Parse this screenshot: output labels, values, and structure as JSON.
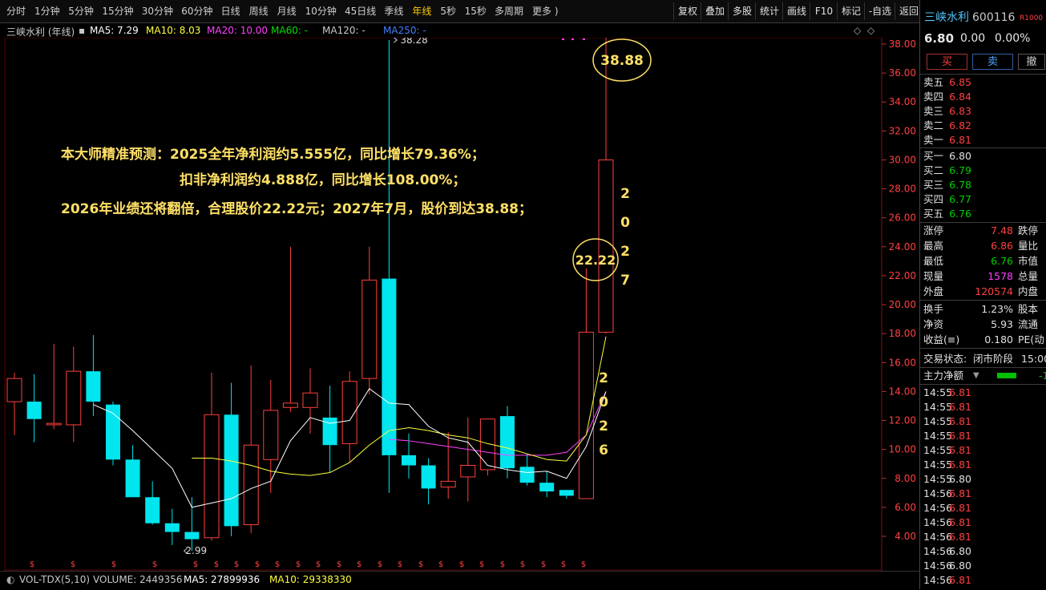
{
  "tabs": [
    "分时",
    "1分钟",
    "5分钟",
    "15分钟",
    "30分钟",
    "60分钟",
    "日线",
    "周线",
    "月线",
    "10分钟",
    "45日线",
    "季线",
    "年线",
    "5秒",
    "15秒",
    "多周期",
    "更多 )"
  ],
  "active_tab": "年线",
  "tools": [
    "复权",
    "叠加",
    "多股",
    "统计",
    "画线",
    "F10",
    "标记",
    "-自选",
    "返回"
  ],
  "info": {
    "name": "三峡水利 (年线)",
    "ma5": "MA5: 7.29",
    "ma10": "MA10: 8.03",
    "ma20": "MA20: 10.00",
    "ma60": "MA60: -",
    "ma120": "MA120: -",
    "ma250": "MA250: -"
  },
  "colors": {
    "up": "#ff4040",
    "down": "#00e5ee",
    "ma5": "#ffffff",
    "ma10": "#ffff40",
    "ma20": "#ff40ff",
    "ma60": "#00e000",
    "ma120": "#40ff40",
    "ma250": "#4080ff",
    "annotation": "#ffe066"
  },
  "annotations": {
    "line1": "本大师精准预测：2025全年净利润约5.555亿，同比增长79.36%；",
    "line2": "扣非净利润约4.888亿，同比增长108.00%；",
    "line3": "2026年业绩还将翻倍，合理股价22.22元；2027年7月，股价到达38.88；"
  },
  "chart_data": {
    "type": "candlestick",
    "y_ticks": [
      "38.00",
      "36.00",
      "34.00",
      "32.00",
      "30.00",
      "28.00",
      "26.00",
      "24.00",
      "22.00",
      "20.00",
      "18.00",
      "16.00",
      "14.00",
      "12.00",
      "10.00",
      "8.00",
      "6.00",
      "4.00"
    ],
    "ylim": [
      2.2,
      39.8
    ],
    "candles": [
      {
        "o": 13.3,
        "h": 15.3,
        "l": 11.0,
        "c": 14.9
      },
      {
        "o": 13.3,
        "h": 15.2,
        "l": 10.5,
        "c": 12.1
      },
      {
        "o": 11.7,
        "h": 17.3,
        "l": 11.4,
        "c": 11.8
      },
      {
        "o": 11.7,
        "h": 17.1,
        "l": 10.5,
        "c": 15.4
      },
      {
        "o": 15.4,
        "h": 17.9,
        "l": 12.3,
        "c": 13.3
      },
      {
        "o": 13.1,
        "h": 13.3,
        "l": 8.9,
        "c": 9.3
      },
      {
        "o": 9.3,
        "h": 10.3,
        "l": 6.9,
        "c": 6.7
      },
      {
        "o": 6.7,
        "h": 7.8,
        "l": 4.8,
        "c": 4.9
      },
      {
        "o": 4.9,
        "h": 5.9,
        "l": 3.4,
        "c": 4.3
      },
      {
        "o": 4.3,
        "h": 6.7,
        "l": 2.99,
        "c": 3.8
      },
      {
        "o": 3.9,
        "h": 15.3,
        "l": 3.7,
        "c": 12.4
      },
      {
        "o": 12.4,
        "h": 14.6,
        "l": 4.0,
        "c": 4.7
      },
      {
        "o": 4.8,
        "h": 15.8,
        "l": 4.2,
        "c": 10.3
      },
      {
        "o": 9.3,
        "h": 14.8,
        "l": 7.0,
        "c": 12.7
      },
      {
        "o": 12.9,
        "h": 24.0,
        "l": 12.6,
        "c": 13.2
      },
      {
        "o": 12.9,
        "h": 15.6,
        "l": 11.1,
        "c": 13.9
      },
      {
        "o": 12.2,
        "h": 14.4,
        "l": 8.4,
        "c": 10.3
      },
      {
        "o": 10.4,
        "h": 15.4,
        "l": 9.1,
        "c": 14.7
      },
      {
        "o": 14.9,
        "h": 24.0,
        "l": 13.8,
        "c": 21.7
      },
      {
        "o": 21.8,
        "h": 38.28,
        "l": 7.0,
        "c": 9.6
      },
      {
        "o": 9.6,
        "h": 11.1,
        "l": 8.0,
        "c": 8.9
      },
      {
        "o": 8.9,
        "h": 9.4,
        "l": 6.2,
        "c": 7.3
      },
      {
        "o": 7.4,
        "h": 11.2,
        "l": 6.6,
        "c": 7.8
      },
      {
        "o": 8.1,
        "h": 12.2,
        "l": 6.4,
        "c": 8.9
      },
      {
        "o": 8.6,
        "h": 12.1,
        "l": 8.2,
        "c": 12.1
      },
      {
        "o": 12.3,
        "h": 13.0,
        "l": 8.0,
        "c": 8.7
      },
      {
        "o": 8.8,
        "h": 9.7,
        "l": 7.5,
        "c": 7.7
      },
      {
        "o": 7.7,
        "h": 8.5,
        "l": 6.7,
        "c": 7.1
      },
      {
        "o": 7.2,
        "h": 7.2,
        "l": 6.6,
        "c": 6.8
      },
      {
        "o": 6.6,
        "h": 22.5,
        "l": 6.6,
        "c": 18.1
      },
      {
        "o": 18.1,
        "h": 38.88,
        "l": 18.0,
        "c": 30.0
      }
    ],
    "ma5": [
      null,
      null,
      null,
      null,
      13.1,
      12.5,
      11.3,
      10.0,
      8.7,
      6.0,
      6.3,
      6.6,
      7.3,
      7.8,
      10.6,
      12.2,
      11.8,
      12.0,
      14.2,
      13.2,
      13.1,
      11.6,
      10.8,
      10.5,
      8.9,
      8.6,
      8.4,
      8.5,
      8.0,
      10.2,
      14.0
    ],
    "ma10": [
      null,
      null,
      null,
      null,
      null,
      null,
      null,
      null,
      null,
      9.4,
      9.4,
      9.2,
      8.9,
      8.5,
      8.3,
      8.2,
      8.4,
      9.1,
      10.3,
      11.3,
      11.5,
      11.3,
      11.0,
      10.8,
      10.4,
      10.1,
      9.7,
      9.3,
      9.2,
      11.0,
      17.8
    ],
    "ma20": [
      null,
      null,
      null,
      null,
      null,
      null,
      null,
      null,
      null,
      null,
      null,
      null,
      null,
      null,
      null,
      null,
      null,
      null,
      null,
      10.7,
      10.6,
      10.4,
      10.2,
      10.0,
      9.8,
      9.6,
      9.6,
      9.6,
      9.8,
      11.0,
      14.0
    ],
    "labels": {
      "high": "38.28",
      "low": "2.99",
      "circle_top": "38.88",
      "circle_mid": "22.22",
      "vert_2026": "2026",
      "vert_2027": "2027"
    }
  },
  "volume": {
    "label": "VOL-TDX(5,10)",
    "volume": "VOLUME: 2449356",
    "ma5": "MA5: 27899936",
    "ma10": "MA10: 29338330"
  },
  "quote": {
    "name": "三峡水利",
    "code": "600116",
    "badge": "R1000",
    "price": "6.80",
    "change": "0.00",
    "pct": "0.00%",
    "buy_label": "买",
    "sell_label": "卖",
    "cancel_label": "撤",
    "asks": [
      {
        "label": "卖五",
        "price": "6.85"
      },
      {
        "label": "卖四",
        "price": "6.84"
      },
      {
        "label": "卖三",
        "price": "6.83"
      },
      {
        "label": "卖二",
        "price": "6.82"
      },
      {
        "label": "卖一",
        "price": "6.81"
      }
    ],
    "bids": [
      {
        "label": "买一",
        "price": "6.80"
      },
      {
        "label": "买二",
        "price": "6.79"
      },
      {
        "label": "买三",
        "price": "6.78"
      },
      {
        "label": "买四",
        "price": "6.77"
      },
      {
        "label": "买五",
        "price": "6.76"
      }
    ],
    "stats": [
      {
        "l": "涨停",
        "v": "7.48",
        "r": "跌停"
      },
      {
        "l": "最高",
        "v": "6.86",
        "r": "量比"
      },
      {
        "l": "最低",
        "v": "6.76",
        "r": "市值"
      },
      {
        "l": "现量",
        "v": "1578",
        "r": "总量"
      },
      {
        "l": "外盘",
        "v": "120574",
        "r": "内盘"
      }
    ],
    "stats2": [
      {
        "l": "换手",
        "v": "1.23%",
        "r": "股本"
      },
      {
        "l": "净资",
        "v": "5.93",
        "r": "流通"
      },
      {
        "l": "收益(≡)",
        "v": "0.180",
        "r": "PE(动"
      }
    ],
    "trade_status_label": "交易状态:",
    "trade_status": "闭市阶段",
    "trade_time": "15:00",
    "net_flow_label": "主力净额",
    "net_flow_value": "-1",
    "ticks": [
      {
        "t": "14:55",
        "p": "6.81"
      },
      {
        "t": "14:55",
        "p": "6.81"
      },
      {
        "t": "14:55",
        "p": "6.81"
      },
      {
        "t": "14:55",
        "p": "6.81"
      },
      {
        "t": "14:55",
        "p": "6.81"
      },
      {
        "t": "14:55",
        "p": "6.81"
      },
      {
        "t": "14:55",
        "p": "6.80"
      },
      {
        "t": "14:56",
        "p": "6.81"
      },
      {
        "t": "14:56",
        "p": "6.81"
      },
      {
        "t": "14:56",
        "p": "6.81"
      },
      {
        "t": "14:56",
        "p": "6.81"
      },
      {
        "t": "14:56",
        "p": "6.80"
      },
      {
        "t": "14:56",
        "p": "6.80"
      },
      {
        "t": "14:56",
        "p": "6.81"
      }
    ]
  }
}
